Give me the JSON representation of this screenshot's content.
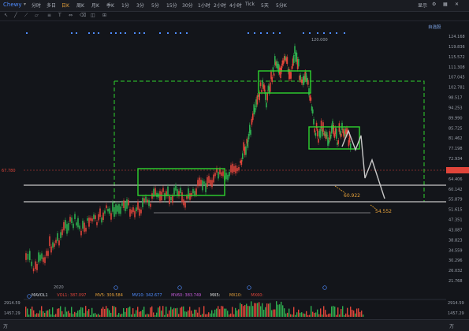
{
  "ticker": "Chewy",
  "tabs": [
    "分时",
    "多日",
    "日K",
    "周K",
    "月K",
    "季K",
    "1分",
    "3分",
    "5分",
    "15分",
    "30分",
    "1小时",
    "2小时",
    "4小时",
    "Tick",
    "5天",
    "5分K"
  ],
  "active_tab": "日K",
  "right_tools": [
    "显示",
    "▾"
  ],
  "toolbar_icons": [
    "cursor-icon",
    "line-icon",
    "ray-icon",
    "channel-icon",
    "fib-icon",
    "text-icon",
    "measure-icon",
    "eraser-icon",
    "layers-icon",
    "grid-icon"
  ],
  "watch_label": "自选股",
  "price_axis": [
    "124.168",
    "119.836",
    "115.572",
    "111.308",
    "107.045",
    "102.781",
    "98.517",
    "94.253",
    "89.990",
    "85.725",
    "81.462",
    "77.198",
    "72.934",
    "67.780",
    "64.406",
    "60.142",
    "55.879",
    "51.615",
    "47.351",
    "43.087",
    "38.823",
    "34.559",
    "30.296",
    "26.032",
    "21.768"
  ],
  "current_price_label": "67.780",
  "peak_label": "120.000",
  "target_label_1": "60.922",
  "target_label_2": "54.552",
  "date_label": "2020",
  "volume_legend": {
    "name": "MAVOL1",
    "vol": "VOL1: 387.097",
    "mv5": "MV5: 309.584",
    "mv10": "MV10: 342.677",
    "mv60": "MV60: 383.749",
    "mx5": "MX5:",
    "mx10": "MX10:",
    "mx60": "MX60:"
  },
  "volume_axis": [
    "2914.59",
    "1457.29",
    "万"
  ],
  "colors": {
    "up": "#2eae4f",
    "down": "#e0453a",
    "box": "#2fd32f",
    "line": "#c8c8c8",
    "price_line": "#e0453a"
  }
}
